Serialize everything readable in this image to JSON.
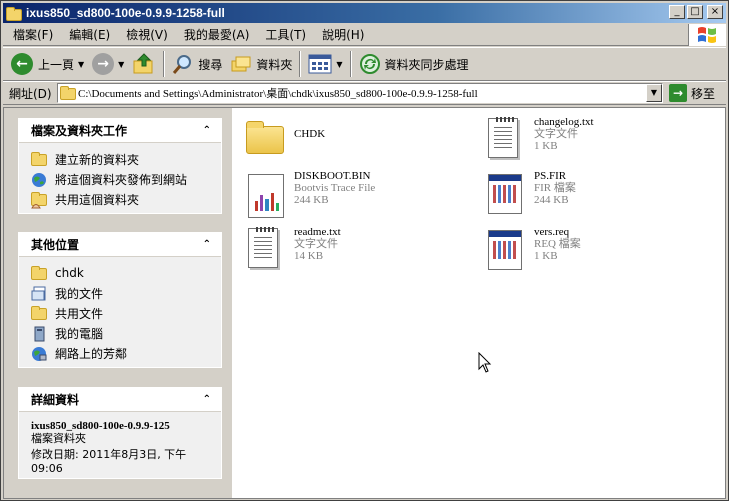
{
  "window": {
    "title": "ixus850_sd800-100e-0.9.9-1258-full",
    "controls": {
      "minimize": "_",
      "maximize": "□",
      "close": "×"
    }
  },
  "menu": {
    "items": [
      "檔案(F)",
      "編輯(E)",
      "檢視(V)",
      "我的最愛(A)",
      "工具(T)",
      "說明(H)"
    ]
  },
  "toolbar": {
    "back_label": "上一頁",
    "search_label": "搜尋",
    "folders_label": "資料夾",
    "sync_label": "資料夾同步處理"
  },
  "address": {
    "label": "網址(D)",
    "value": "C:\\Documents and Settings\\Administrator\\桌面\\chdk\\ixus850_sd800-100e-0.9.9-1258-full",
    "go_label": "移至"
  },
  "taskpane": {
    "file_tasks": {
      "title": "檔案及資料夾工作",
      "items": [
        "建立新的資料夾",
        "將這個資料夾發佈到網站",
        "共用這個資料夾"
      ]
    },
    "other_places": {
      "title": "其他位置",
      "items": [
        "chdk",
        "我的文件",
        "共用文件",
        "我的電腦",
        "網路上的芳鄰"
      ]
    },
    "details": {
      "title": "詳細資料",
      "name": "ixus850_sd800-100e-0.9.9-125",
      "type": "檔案資料夾",
      "modified_line1": "修改日期: 2011年8月3日, 下午",
      "modified_line2": "09:06"
    }
  },
  "files": [
    {
      "name": "CHDK",
      "type": "",
      "size": ""
    },
    {
      "name": "changelog.txt",
      "type": "文字文件",
      "size": "1 KB"
    },
    {
      "name": "DISKBOOT.BIN",
      "type": "Bootvis Trace File",
      "size": "244 KB"
    },
    {
      "name": "PS.FIR",
      "type": "FIR 檔案",
      "size": "244 KB"
    },
    {
      "name": "readme.txt",
      "type": "文字文件",
      "size": "14 KB"
    },
    {
      "name": "vers.req",
      "type": "REQ 檔案",
      "size": "1 KB"
    }
  ],
  "colors": {
    "title_active_start": "#0A246A",
    "title_active_end": "#A6CAF0",
    "face": "#D4D0C8",
    "folder": "#F3D46A"
  }
}
